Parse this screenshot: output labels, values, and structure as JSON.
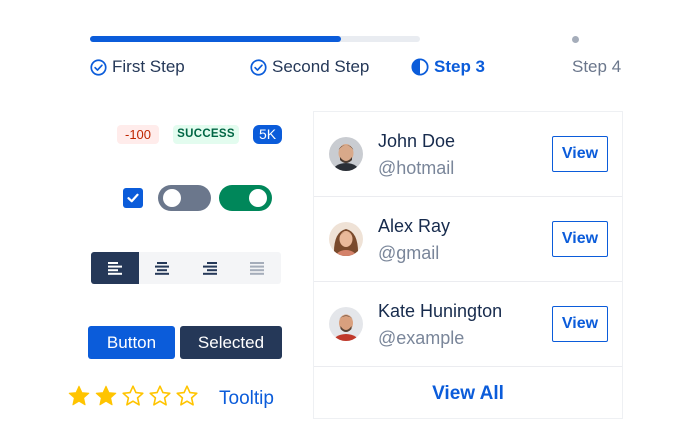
{
  "stepper": {
    "progress_percent": 76,
    "steps": [
      {
        "label": "First Step",
        "state": "done",
        "icon": "check-circle-icon"
      },
      {
        "label": "Second Step",
        "state": "done",
        "icon": "check-circle-icon"
      },
      {
        "label": "Step 3",
        "state": "current",
        "icon": "half-circle-icon"
      },
      {
        "label": "Step 4",
        "state": "pending",
        "icon": "dot-icon"
      }
    ]
  },
  "badges": {
    "negative": "-100",
    "success": "SUCCESS",
    "count": "5K"
  },
  "controls": {
    "checkbox_checked": true,
    "toggle_off": false,
    "toggle_on": true
  },
  "alignment": {
    "options": [
      "align-left-icon",
      "align-center-icon",
      "align-right-icon",
      "align-justify-icon"
    ],
    "selected": "align-left-icon"
  },
  "buttons": {
    "primary_label": "Button",
    "selected_label": "Selected"
  },
  "rating": {
    "value": 2,
    "max": 5
  },
  "tooltip_label": "Tooltip",
  "users": [
    {
      "name": "John Doe",
      "handle": "@hotmail",
      "action": "View"
    },
    {
      "name": "Alex Ray",
      "handle": "@gmail",
      "action": "View"
    },
    {
      "name": "Kate Hunington",
      "handle": "@example",
      "action": "View"
    }
  ],
  "view_all_label": "View All",
  "colors": {
    "primary": "#0b5cda",
    "dark": "#253858",
    "success": "#00875a",
    "neutral": "#6b778c",
    "star": "#ffc400"
  }
}
